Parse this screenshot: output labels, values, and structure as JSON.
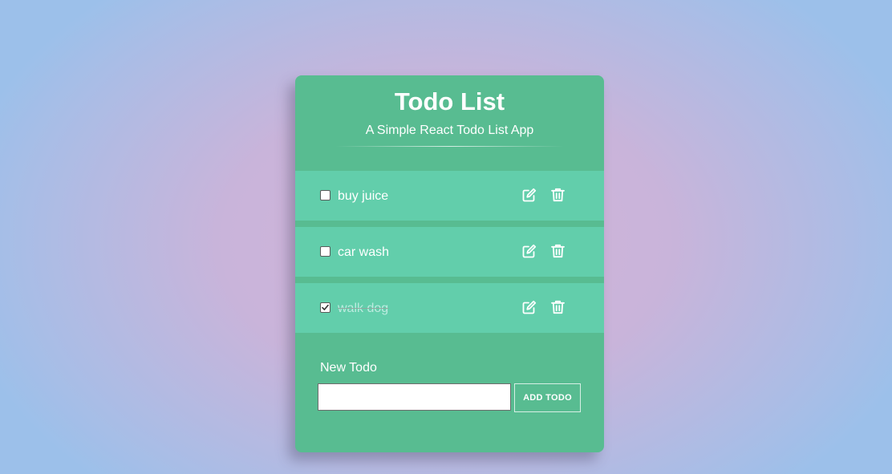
{
  "app": {
    "title": "Todo List",
    "subtitle": "A Simple React Todo List App"
  },
  "todos": [
    {
      "text": "buy juice",
      "completed": false
    },
    {
      "text": "car wash",
      "completed": false
    },
    {
      "text": "walk dog",
      "completed": true
    }
  ],
  "icons": {
    "edit": "edit-icon",
    "delete": "trash-icon"
  },
  "new_todo": {
    "label": "New Todo",
    "value": "",
    "button_label": "ADD TODO"
  },
  "colors": {
    "card_background": "#58bc91",
    "todo_item_background": "#62ceab",
    "text": "#ffffff"
  }
}
